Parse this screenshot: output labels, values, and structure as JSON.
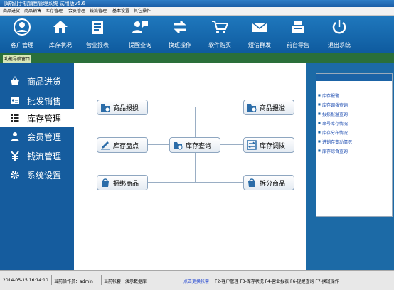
{
  "window": {
    "title": "[联智]手机销售管理系统 试用版v5.6"
  },
  "menu": [
    "商品进货",
    "商品销售",
    "库存管理",
    "会员管理",
    "钱流管理",
    "基本设置",
    "其它操作"
  ],
  "toolbar": [
    {
      "label": "客户管理",
      "icon": "customer-icon"
    },
    {
      "label": "库存状况",
      "icon": "house-icon"
    },
    {
      "label": "营业报表",
      "icon": "report-icon"
    },
    {
      "label": "提醒查询",
      "icon": "chat-icon"
    },
    {
      "label": "换班操作",
      "icon": "swap-icon"
    },
    {
      "label": "软件购买",
      "icon": "cart-icon"
    },
    {
      "label": "短信群发",
      "icon": "mail-icon"
    },
    {
      "label": "前台零售",
      "icon": "register-icon"
    },
    {
      "label": "退出系统",
      "icon": "power-icon"
    }
  ],
  "nav_header": "功能导航窗口",
  "sidebar": [
    {
      "label": "商品进货",
      "icon": "basket-icon"
    },
    {
      "label": "批发销售",
      "icon": "card-icon"
    },
    {
      "label": "库存管理",
      "icon": "grid-icon",
      "active": true
    },
    {
      "label": "会员管理",
      "icon": "person-icon"
    },
    {
      "label": "钱流管理",
      "icon": "yen-icon"
    },
    {
      "label": "系统设置",
      "icon": "gear-icon"
    }
  ],
  "flow": {
    "loss": "商品报损",
    "overflow": "商品报溢",
    "count": "库存盘点",
    "query": "库存查询",
    "transfer": "库存调拨",
    "bundle": "捆绑商品",
    "split": "拆分商品"
  },
  "quick_links": [
    "库存报警",
    "库存调拨查询",
    "报损报溢查询",
    "串号库存情况",
    "库存分布情况",
    "进销存变动情况",
    "库存综合查询"
  ],
  "status": {
    "datetime": "2014-05-15 16:14:10",
    "operator": "当前操作员：admin",
    "account": "当前帐套：演示数据库",
    "change_account": "点击更换帐套",
    "shortcuts": "F2-客户管理 F3-库存状况 F4-营业报表 F6-提醒查询 F7-换班操作"
  }
}
